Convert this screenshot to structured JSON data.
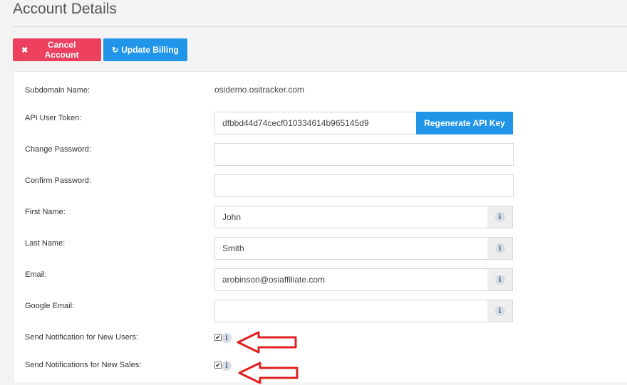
{
  "page": {
    "title": "Account Details"
  },
  "actions": {
    "cancel": {
      "icon": "close-icon",
      "glyph": "✖",
      "label": "Cancel Account"
    },
    "update": {
      "icon": "refresh-icon",
      "glyph": "↻",
      "label": "Update Billing"
    }
  },
  "form": {
    "subdomain": {
      "label": "Subdomain Name:",
      "value": "osidemo.ositracker.com"
    },
    "api_token": {
      "label": "API User Token:",
      "value": "dfbbd44d74cecf010334614b965145d9",
      "button": "Regenerate API Key"
    },
    "change_password": {
      "label": "Change Password:",
      "value": ""
    },
    "confirm_password": {
      "label": "Confirm Password:",
      "value": ""
    },
    "first_name": {
      "label": "First Name:",
      "value": "John"
    },
    "last_name": {
      "label": "Last Name:",
      "value": "Smith"
    },
    "email": {
      "label": "Email:",
      "value": "arobinson@osiaffiliate.com"
    },
    "google_email": {
      "label": "Google Email:",
      "value": ""
    },
    "notify_new_users": {
      "label": "Send Notification for New Users:",
      "checked": true
    },
    "notify_new_sales": {
      "label": "Send Notifications for New Sales:",
      "checked": true
    },
    "info_glyph": "i",
    "check_glyph": "✔"
  },
  "colors": {
    "danger": "#ed3f5e",
    "primary": "#2196e8",
    "annotation_arrow": "#e02020"
  }
}
